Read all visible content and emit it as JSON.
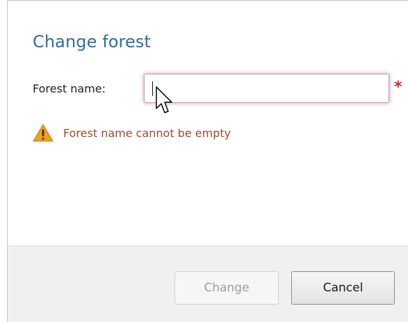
{
  "dialog": {
    "title": "Change forest",
    "field": {
      "label": "Forest name:",
      "value": "",
      "placeholder": "",
      "required_marker": "*"
    },
    "validation": {
      "icon": "warning-icon",
      "message": "Forest name cannot be empty"
    },
    "buttons": {
      "change_label": "Change",
      "cancel_label": "Cancel"
    }
  },
  "colors": {
    "title": "#2e6da4",
    "error_text": "#a8472a",
    "required_marker": "#e0202e",
    "warning_icon": "#f0a020",
    "footer_background": "#f0f0f0"
  }
}
